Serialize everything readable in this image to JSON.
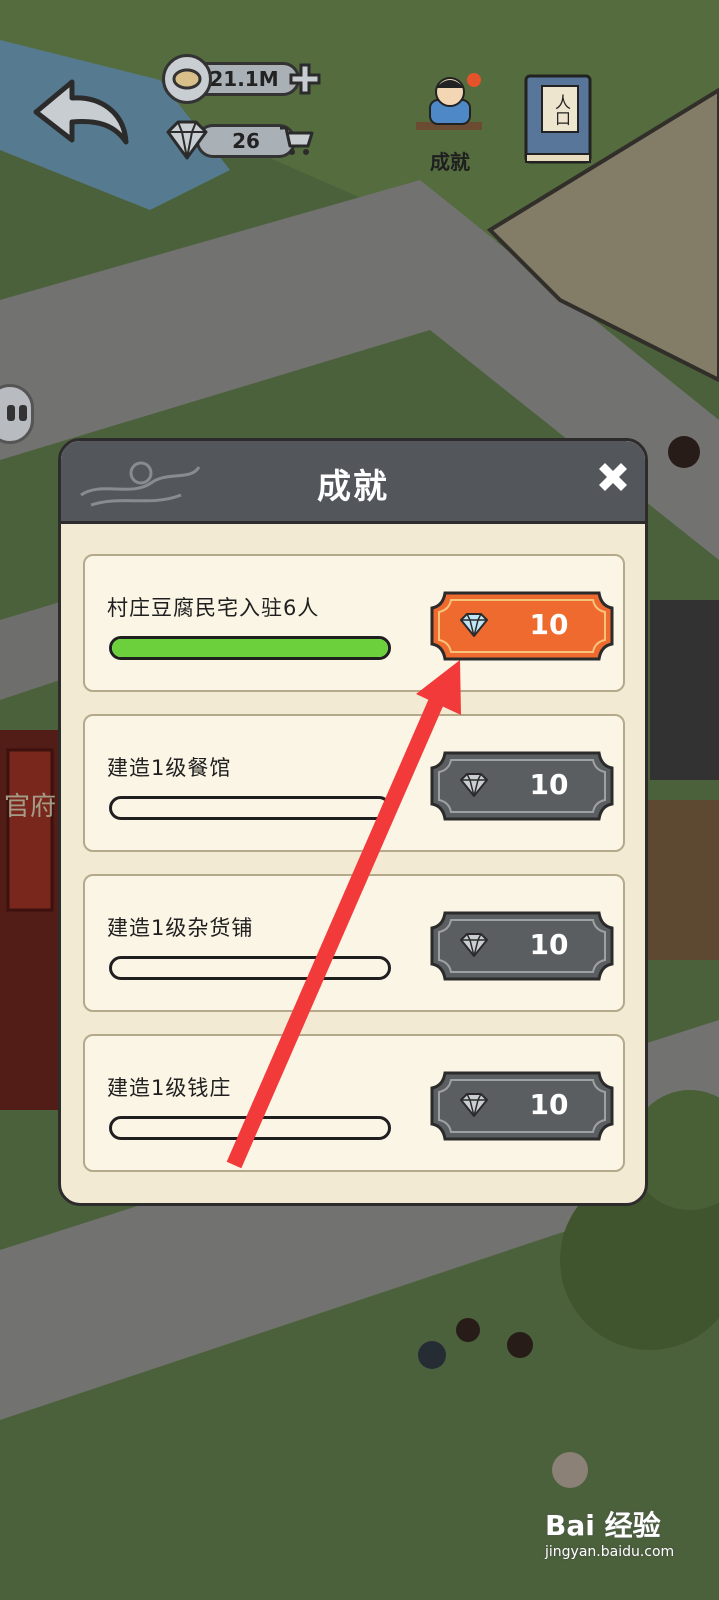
{
  "hud": {
    "coins": "21.1M",
    "gems": "26",
    "achievements_label": "成就",
    "population_label": "人口"
  },
  "scene": {
    "government_sign": "官府"
  },
  "modal": {
    "title": "成就",
    "achievements": [
      {
        "title": "村庄豆腐民宅入驻6人",
        "progress": 1.0,
        "reward": "10",
        "claimable": true
      },
      {
        "title": "建造1级餐馆",
        "progress": 0.0,
        "reward": "10",
        "claimable": false
      },
      {
        "title": "建造1级杂货铺",
        "progress": 0.0,
        "reward": "10",
        "claimable": false
      },
      {
        "title": "建造1级钱庄",
        "progress": 0.0,
        "reward": "10",
        "claimable": false
      }
    ]
  },
  "colors": {
    "claimable": "#ee6a2e",
    "locked": "#5b5e61",
    "progress": "#6cd03d",
    "annotation_arrow": "#f23a3a"
  },
  "watermark": {
    "logo": "Bai 经验",
    "url": "jingyan.baidu.com"
  }
}
